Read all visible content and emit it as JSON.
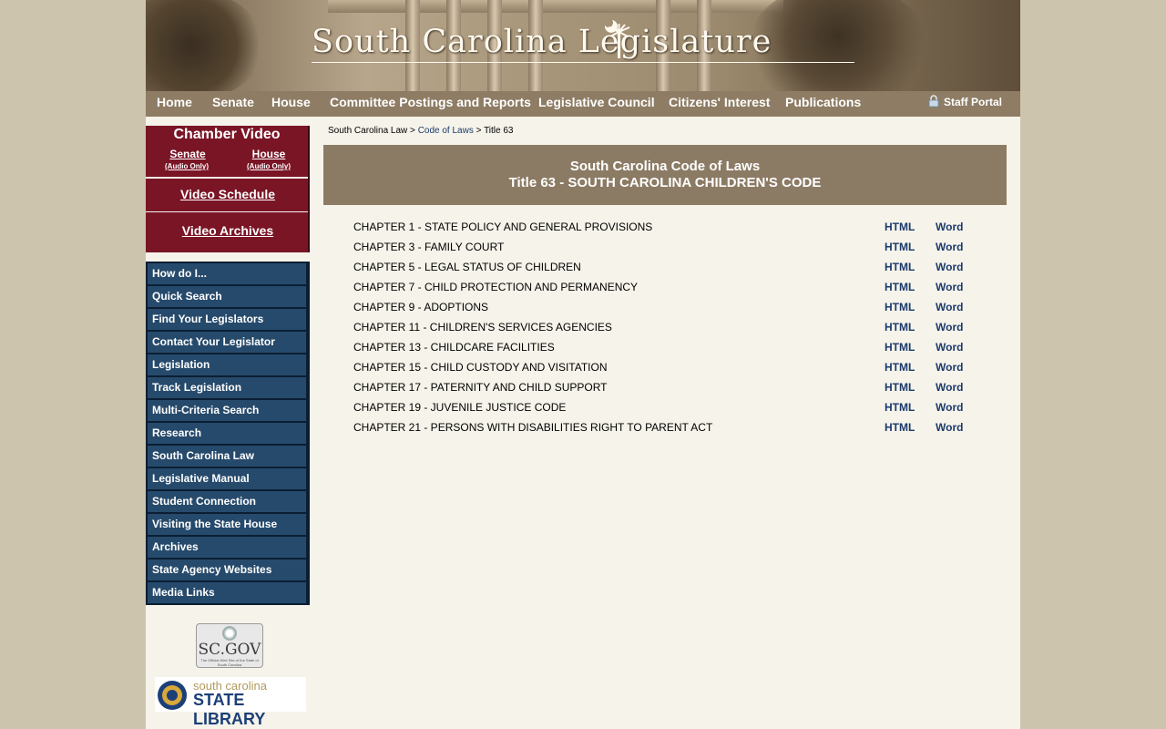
{
  "banner": {
    "site_title": "South Carolina Legislature"
  },
  "topnav": {
    "items": [
      "Home",
      "Senate",
      "House",
      "Committee Postings and Reports",
      "Legislative Council",
      "Citizens' Interest",
      "Publications"
    ],
    "staff_portal": "Staff Portal"
  },
  "chamber_video": {
    "title": "Chamber Video",
    "senate": "Senate",
    "senate_sub": "(Audio Only)",
    "house": "House",
    "house_sub": "(Audio Only)",
    "schedule": "Video Schedule",
    "archives": "Video Archives"
  },
  "side_menu": {
    "items": [
      "How do I...",
      "Quick Search",
      "Find Your Legislators",
      "Contact Your Legislator",
      "Legislation",
      "Track Legislation",
      "Multi-Criteria Search",
      "Research",
      "South Carolina Law",
      "Legislative Manual",
      "Student Connection",
      "Visiting the State House",
      "Archives",
      "State Agency Websites",
      "Media Links"
    ]
  },
  "logos": {
    "scgov": "SC.GOV",
    "scgov_tagline": "The Official Web Site of the State of South Carolina",
    "state_library_line1": "south carolina",
    "state_library_line2": "STATE LIBRARY"
  },
  "breadcrumb": {
    "root": "South Carolina Law",
    "sep1": " > ",
    "code": "Code of Laws",
    "sep2": " > ",
    "current": "Title 63"
  },
  "heading": {
    "line1": "South Carolina Code of Laws",
    "line2": "Title 63 - SOUTH CAROLINA CHILDREN'S CODE"
  },
  "chapter_links": {
    "html": "HTML",
    "word": "Word"
  },
  "chapters": [
    "CHAPTER 1 - STATE POLICY AND GENERAL PROVISIONS",
    "CHAPTER 3 - FAMILY COURT",
    "CHAPTER 5 - LEGAL STATUS OF CHILDREN",
    "CHAPTER 7 - CHILD PROTECTION AND PERMANENCY",
    "CHAPTER 9 - ADOPTIONS",
    "CHAPTER 11 - CHILDREN'S SERVICES AGENCIES",
    "CHAPTER 13 - CHILDCARE FACILITIES",
    "CHAPTER 15 - CHILD CUSTODY AND VISITATION",
    "CHAPTER 17 - PATERNITY AND CHILD SUPPORT",
    "CHAPTER 19 - JUVENILE JUSTICE CODE",
    "CHAPTER 21 - PERSONS WITH DISABILITIES RIGHT TO PARENT ACT"
  ],
  "colors": {
    "page_bg": "#cdc4ad",
    "content_bg": "#f6f3ea",
    "nav_bg": "#8e7c64",
    "chamber_bg": "#7a1526",
    "menu_bg": "#264a6b",
    "link": "#1b3a6b"
  }
}
